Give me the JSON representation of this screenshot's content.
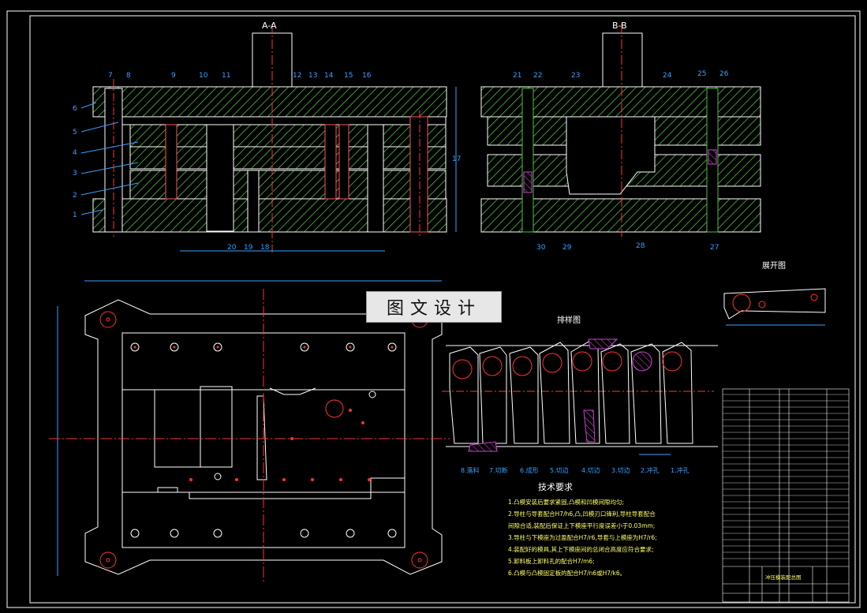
{
  "view_aa": {
    "title": "A-A",
    "numbers": [
      "1",
      "2",
      "3",
      "4",
      "5",
      "6",
      "7",
      "8",
      "9",
      "10",
      "11",
      "12",
      "13",
      "14",
      "15",
      "16",
      "17",
      "18",
      "19",
      "20"
    ]
  },
  "view_bb": {
    "title": "B-B",
    "numbers": [
      "21",
      "22",
      "23",
      "24",
      "25",
      "26",
      "27",
      "28",
      "29",
      "30"
    ]
  },
  "unfold_title": "展开图",
  "layout_title": "排样图",
  "watermark": "图文设计",
  "stations": [
    "8.落料",
    "7.切断",
    "6.成形",
    "5.切边",
    "4.切边",
    "3.切边",
    "2.冲孔",
    "1.冲孔"
  ],
  "tech": {
    "title": "技术要求",
    "lines": [
      "1.凸模安装后要求紧固,凸模和凹模间隙均匀;",
      "2.导柱与导套配合H7/h6,凸,凹模刃口锋利,导柱导套配合",
      "  间隙合适,装配后保证上下模座平行度误差小于0.03mm;",
      "3.导柱与下模座为过盈配合H7/r6,导套与上模座为H7/r6;",
      "4.装配好的模具,其上下模座间的总闭合高度应符合要求;",
      "5.卸料板上卸料孔的配合H7/m6;",
      "6.凸模与凸模固定板的配合H7/n6或H7/k6。"
    ]
  },
  "title_block": "冲压模装配总图"
}
